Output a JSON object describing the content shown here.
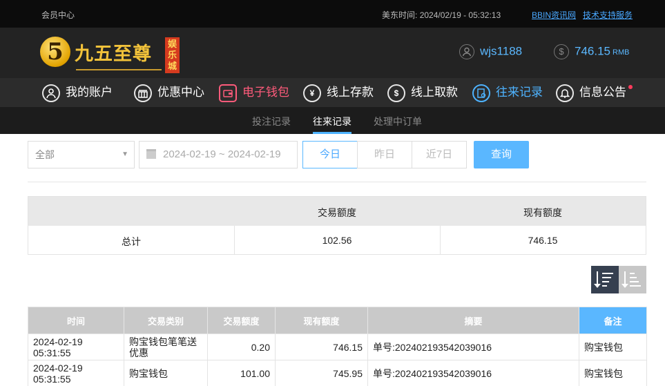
{
  "topbar": {
    "member_center": "会员中心",
    "time_label": "美东时间:",
    "time_value": "2024/02/19 - 05:32:13",
    "link1": "BBIN资讯网",
    "link2": "技术支持服务"
  },
  "header": {
    "logo_digit": "5",
    "logo_text": "九五至尊",
    "logo_tag": "娱乐城",
    "username": "wjs1188",
    "balance": "746.15",
    "currency": "RMB",
    "currency_icon": "$"
  },
  "nav": {
    "items": [
      {
        "label": "我的账户",
        "icon": "user-icon"
      },
      {
        "label": "优惠中心",
        "icon": "gift-icon"
      },
      {
        "label": "电子钱包",
        "icon": "wallet-icon"
      },
      {
        "label": "线上存款",
        "icon": "deposit-icon"
      },
      {
        "label": "线上取款",
        "icon": "withdraw-icon"
      },
      {
        "label": "往来记录",
        "icon": "records-icon"
      },
      {
        "label": "信息公告",
        "icon": "bell-icon"
      }
    ]
  },
  "subnav": {
    "items": [
      "投注记录",
      "往来记录",
      "处理中订单"
    ]
  },
  "filter": {
    "select_value": "全部",
    "date_range": "2024-02-19 ~ 2024-02-19",
    "today": "今日",
    "yesterday": "昨日",
    "last7": "近7日",
    "search": "查询"
  },
  "summary": {
    "col_trade": "交易额度",
    "col_current": "现有额度",
    "row_label": "总计",
    "trade_total": "102.56",
    "current_total": "746.15"
  },
  "records": {
    "headers": [
      "时间",
      "交易类别",
      "交易额度",
      "现有额度",
      "摘要",
      "备注"
    ],
    "rows": [
      {
        "time": "2024-02-19 05:31:55",
        "type": "购宝钱包笔笔送优惠",
        "amount": "0.20",
        "balance": "746.15",
        "summary": "单号:202402193542039016",
        "remark": "购宝钱包"
      },
      {
        "time": "2024-02-19 05:31:55",
        "type": "购宝钱包",
        "amount": "101.00",
        "balance": "745.95",
        "summary": "单号:202402193542039016",
        "remark": "购宝钱包"
      }
    ]
  },
  "colors": {
    "accent": "#5ab7ff",
    "wallet": "#ff5b7b",
    "gold": "#f2c23a"
  }
}
